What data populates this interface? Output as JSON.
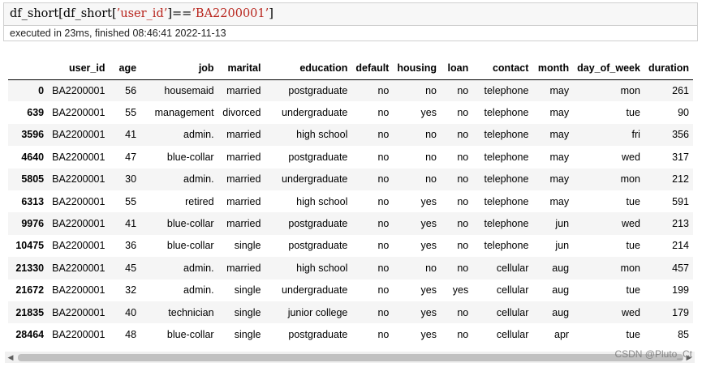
{
  "code_cell": {
    "prefix": "df_short[df_short[",
    "key": "’user_id’",
    "middle": "]==",
    "value": "’BA2200001’",
    "suffix": "]"
  },
  "exec_info": "executed in 23ms, finished 08:46:41 2022-11-13",
  "table": {
    "columns": [
      "user_id",
      "age",
      "job",
      "marital",
      "education",
      "default",
      "housing",
      "loan",
      "contact",
      "month",
      "day_of_week",
      "duration"
    ],
    "rows": [
      {
        "index": "0",
        "cells": [
          "BA2200001",
          "56",
          "housemaid",
          "married",
          "postgraduate",
          "no",
          "no",
          "no",
          "telephone",
          "may",
          "mon",
          "261"
        ]
      },
      {
        "index": "639",
        "cells": [
          "BA2200001",
          "55",
          "management",
          "divorced",
          "undergraduate",
          "no",
          "yes",
          "no",
          "telephone",
          "may",
          "tue",
          "90"
        ]
      },
      {
        "index": "3596",
        "cells": [
          "BA2200001",
          "41",
          "admin.",
          "married",
          "high school",
          "no",
          "no",
          "no",
          "telephone",
          "may",
          "fri",
          "356"
        ]
      },
      {
        "index": "4640",
        "cells": [
          "BA2200001",
          "47",
          "blue-collar",
          "married",
          "postgraduate",
          "no",
          "no",
          "no",
          "telephone",
          "may",
          "wed",
          "317"
        ]
      },
      {
        "index": "5805",
        "cells": [
          "BA2200001",
          "30",
          "admin.",
          "married",
          "undergraduate",
          "no",
          "no",
          "no",
          "telephone",
          "may",
          "mon",
          "212"
        ]
      },
      {
        "index": "6313",
        "cells": [
          "BA2200001",
          "55",
          "retired",
          "married",
          "high school",
          "no",
          "yes",
          "no",
          "telephone",
          "may",
          "tue",
          "591"
        ]
      },
      {
        "index": "9976",
        "cells": [
          "BA2200001",
          "41",
          "blue-collar",
          "married",
          "postgraduate",
          "no",
          "yes",
          "no",
          "telephone",
          "jun",
          "wed",
          "213"
        ]
      },
      {
        "index": "10475",
        "cells": [
          "BA2200001",
          "36",
          "blue-collar",
          "single",
          "postgraduate",
          "no",
          "yes",
          "no",
          "telephone",
          "jun",
          "tue",
          "214"
        ]
      },
      {
        "index": "21330",
        "cells": [
          "BA2200001",
          "45",
          "admin.",
          "married",
          "high school",
          "no",
          "no",
          "no",
          "cellular",
          "aug",
          "mon",
          "457"
        ]
      },
      {
        "index": "21672",
        "cells": [
          "BA2200001",
          "32",
          "admin.",
          "single",
          "undergraduate",
          "no",
          "yes",
          "yes",
          "cellular",
          "aug",
          "tue",
          "199"
        ]
      },
      {
        "index": "21835",
        "cells": [
          "BA2200001",
          "40",
          "technician",
          "single",
          "junior college",
          "no",
          "yes",
          "no",
          "cellular",
          "aug",
          "wed",
          "179"
        ]
      },
      {
        "index": "28464",
        "cells": [
          "BA2200001",
          "48",
          "blue-collar",
          "single",
          "postgraduate",
          "no",
          "yes",
          "no",
          "cellular",
          "apr",
          "tue",
          "85"
        ]
      }
    ]
  },
  "scrollbar": {
    "left_arrow": "◀",
    "right_arrow": "▶"
  },
  "watermark": "CSDN @Pluto_Ct",
  "colors": {
    "string_literal": "#b8241c",
    "cell_background": "#f7f7f7",
    "row_stripe": "#f5f5f5"
  }
}
